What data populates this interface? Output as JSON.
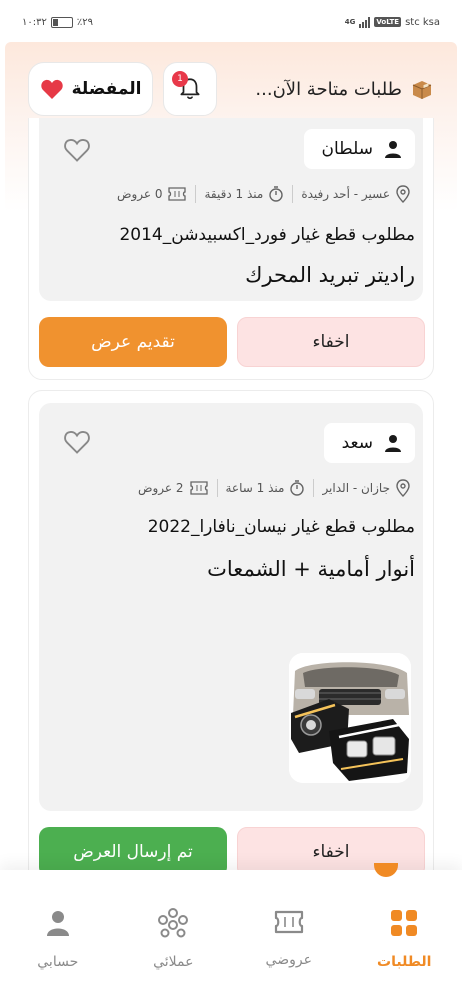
{
  "status_bar": {
    "time": "١٠:٣٢",
    "battery": "٪٢٩",
    "carrier": "stc ksa",
    "network": "4G",
    "volte": "VoLTE"
  },
  "header": {
    "title": "طلبات متاحة الآن...",
    "favorites_label": "المفضلة",
    "notification_count": "1",
    "colors": {
      "heart": "#e63946",
      "badge": "#e8394a"
    }
  },
  "requests": [
    {
      "user": "سلطان",
      "location": "عسير - أحد رفيدة",
      "time_ago": "منذ 1 دقيقة",
      "offers": "0 عروض",
      "subtitle": "مطلوب قطع غيار فورد_اكسبيدشن_2014",
      "title": "راديتر تبريد المحرك",
      "hide_label": "اخفاء",
      "action_label": "تقديم عرض"
    },
    {
      "user": "سعد",
      "location": "جازان - الداير",
      "time_ago": "منذ 1 ساعة",
      "offers": "2 عروض",
      "subtitle": "مطلوب قطع غيار نيسان_نافارا_2022",
      "title": "أنوار أمامية + الشمعات",
      "hide_label": "اخفاء",
      "action_label": "تم إرسال العرض"
    }
  ],
  "nav": [
    {
      "label": "الطلبات",
      "icon": "grid-icon",
      "active": true
    },
    {
      "label": "عروضي",
      "icon": "ticket-icon",
      "active": false
    },
    {
      "label": "عملائي",
      "icon": "group-icon",
      "active": false
    },
    {
      "label": "حسابي",
      "icon": "user-icon",
      "active": false
    }
  ],
  "colors": {
    "accent": "#f0922f",
    "success": "#4caf50",
    "hide_bg": "#fde3e3"
  }
}
